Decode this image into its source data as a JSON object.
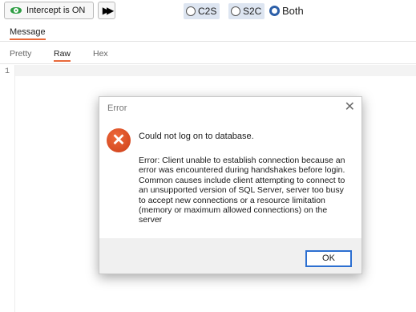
{
  "toolbar": {
    "intercept_label": "Intercept is ON",
    "forward_glyph": "▶▶",
    "direction_options": [
      {
        "label": "C2S",
        "selected": false
      },
      {
        "label": "S2C",
        "selected": false
      },
      {
        "label": "Both",
        "selected": true
      }
    ]
  },
  "message_tab": "Message",
  "view_tabs": [
    {
      "label": "Pretty",
      "active": false
    },
    {
      "label": "Raw",
      "active": true
    },
    {
      "label": "Hex",
      "active": false
    }
  ],
  "editor": {
    "line_number": "1"
  },
  "dialog": {
    "title": "Error",
    "close_glyph": "✕",
    "icon_glyph": "✕",
    "heading": "Could not log on to database.",
    "message": "Error: Client unable to establish connection because an error was encountered during handshakes before login. Common causes include client attempting to connect to an unsupported version of SQL Server, server too busy to accept new connections or a resource limitation (memory or maximum allowed connections) on the server",
    "ok_label": "OK"
  },
  "colors": {
    "accent_tab": "#e8693a",
    "error_icon": "#d9481f",
    "ok_border": "#2c6fd1",
    "intercept_eye": "#2f9e44"
  }
}
